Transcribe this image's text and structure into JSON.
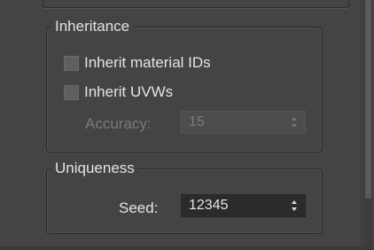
{
  "inheritance": {
    "title": "Inheritance",
    "inherit_material_ids": {
      "label": "Inherit material IDs",
      "checked": false
    },
    "inherit_uvws": {
      "label": "Inherit UVWs",
      "checked": false
    },
    "accuracy": {
      "label": "Accuracy:",
      "value": "15",
      "enabled": false
    }
  },
  "uniqueness": {
    "title": "Uniqueness",
    "seed": {
      "label": "Seed:",
      "value": "12345",
      "enabled": true
    }
  },
  "icons": {
    "spinner_arrows": "up-down-arrows-icon",
    "checkbox": "checkbox-unchecked-icon"
  },
  "colors": {
    "panel_bg": "#444444",
    "field_bg": "#2b2b2b",
    "text": "#e4e4e4",
    "disabled_text": "#7a7a7a"
  }
}
